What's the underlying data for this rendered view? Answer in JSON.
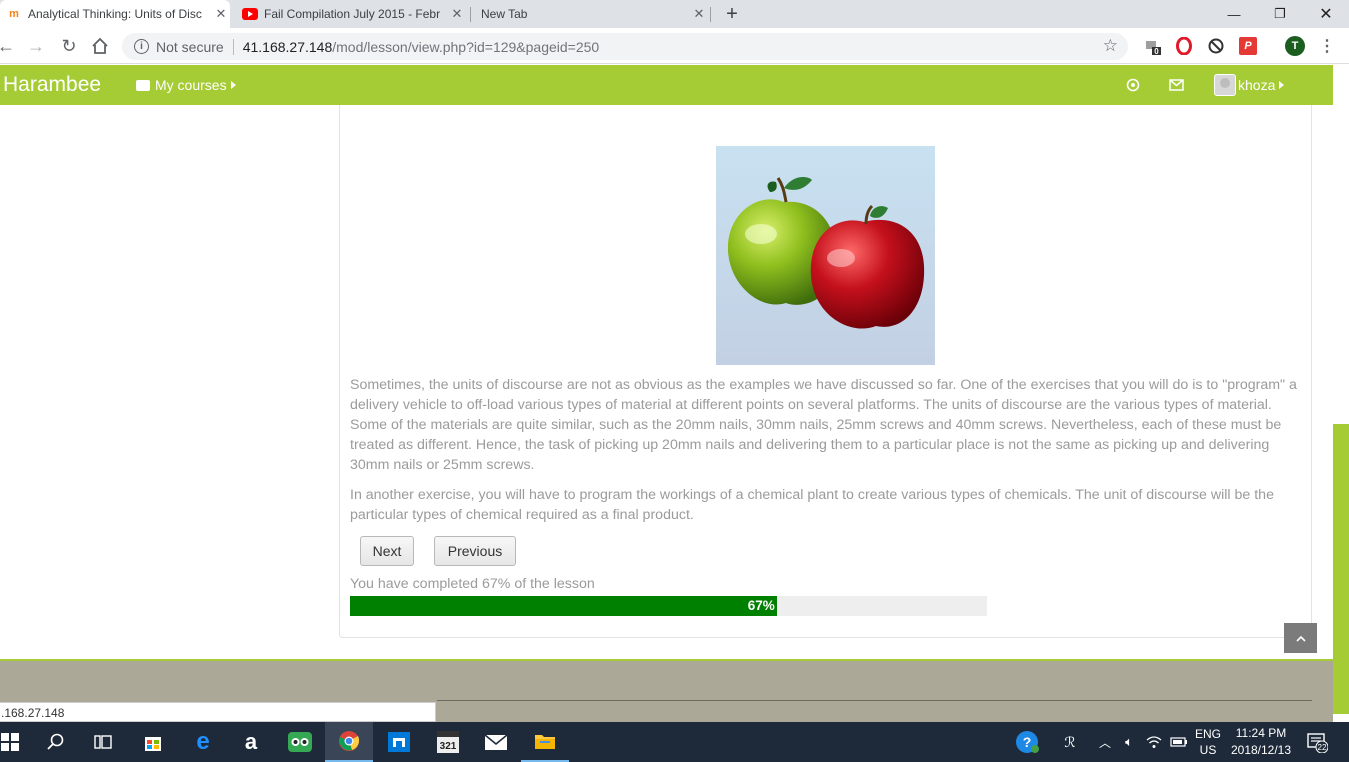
{
  "browser": {
    "tabs": [
      {
        "title": "Analytical Thinking: Units of Disc",
        "favicon": "moodle-icon",
        "active": true
      },
      {
        "title": "Fail Compilation July 2015 - Febr",
        "favicon": "youtube-icon",
        "active": false
      },
      {
        "title": "New Tab",
        "favicon": "",
        "active": false
      }
    ],
    "new_tab_label": "+",
    "security_label": "Not secure",
    "url_host": "41.168.27.148",
    "url_path": "/mod/lesson/view.php?id=129&pageid=250",
    "extensions": [
      {
        "name": "extension-badge-icon",
        "badge": "0"
      },
      {
        "name": "opera-icon",
        "badge": ""
      },
      {
        "name": "block-icon",
        "badge": ""
      },
      {
        "name": "p-icon",
        "badge": ""
      },
      {
        "name": "profile-icon",
        "badge": "T"
      }
    ]
  },
  "navbar": {
    "brand": "Harambee",
    "my_courses": "My courses",
    "username": "khoza",
    "accent": "#a5cc35"
  },
  "lesson": {
    "paragraph1": "Sometimes, the units of discourse are not as obvious as the examples we have discussed so far. One of the exercises that you will do is to \"program\" a delivery vehicle to off-load various types of material at different points on several platforms. The units of discourse are the various types of material. Some of the materials are quite similar, such as the 20mm nails, 30mm nails, 25mm screws and 40mm screws. Nevertheless, each of these must be treated as different. Hence, the task of picking up 20mm nails and delivering them to a particular place is not the same as picking up and delivering 30mm nails or 25mm screws.",
    "paragraph2": "In another exercise, you will have to program the workings of a chemical plant to create various types of chemicals. The unit of discourse will be the particular types of chemical required as a final product.",
    "next_label": "Next",
    "previous_label": "Previous",
    "progress_label": "You have completed 67% of the lesson",
    "progress_text": "67%",
    "progress_value": 0.67,
    "progress_color": "#008000"
  },
  "statusbar": {
    "text": ".168.27.148"
  },
  "taskbar": {
    "apps": [
      "start-icon",
      "search-icon",
      "task-view-icon",
      "store-icon",
      "edge-icon",
      "amazon-icon",
      "tripadvisor-icon",
      "chrome-icon",
      "mail-app-icon",
      "calendar-321-icon",
      "envelope-icon",
      "file-explorer-icon"
    ],
    "lang": "ENG",
    "region": "US",
    "time": "11:24 PM",
    "date": "2018/12/13",
    "notifications": "22"
  }
}
